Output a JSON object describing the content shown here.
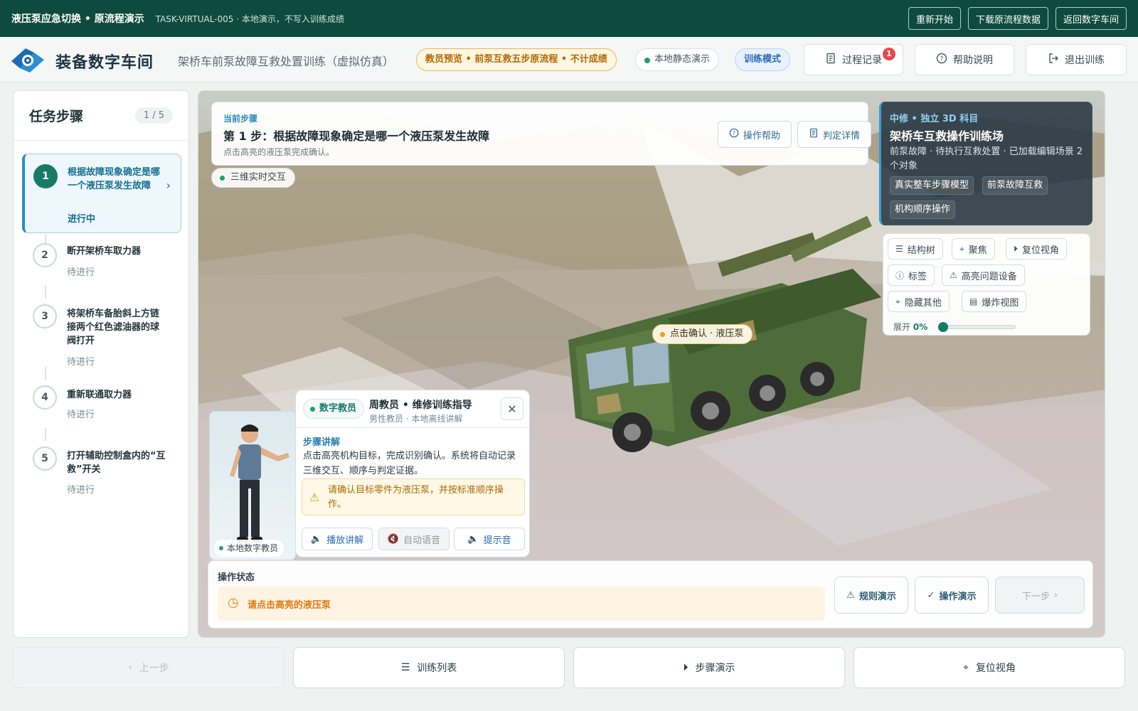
{
  "topbar": {
    "title": "液压泵应急切换 • 原流程演示",
    "task": "TASK-VIRTUAL-005 · 本地演示，不写入训练成绩",
    "buttons": [
      "重新开始",
      "下载原流程数据",
      "返回数字车间"
    ]
  },
  "header": {
    "brand": "装备数字车间",
    "subtitle": "架桥车前泵故障互救处置训练（虚拟仿真）",
    "preview_pill": "教员预览 • 前泵互救五步原流程 • 不计成绩",
    "demo_pill": "本地静态演示",
    "mode_pill": "训练模式",
    "record_button": "过程记录",
    "record_badge": "1",
    "help_button": "帮助说明",
    "exit_button": "退出训练"
  },
  "steps": {
    "title": "任务步骤",
    "count": "1 / 5",
    "items": [
      {
        "num": "1",
        "name": "根据故障现象确定是哪一个液压泵发生故障",
        "state": "进行中"
      },
      {
        "num": "2",
        "name": "断开架桥车取力器",
        "state": "待进行"
      },
      {
        "num": "3",
        "name": "将架桥车备胎斜上方链接两个红色滤油器的球阀打开",
        "state": "待进行"
      },
      {
        "num": "4",
        "name": "重新联通取力器",
        "state": "待进行"
      },
      {
        "num": "5",
        "name": "打开辅助控制盒内的“互救”开关",
        "state": "待进行"
      }
    ]
  },
  "stepcard": {
    "label": "当前步骤",
    "title": "第 1 步：根据故障现象确定是哪一个液压泵发生故障",
    "hint": "点击高亮的液压泵完成确认。",
    "help_button": "操作帮助",
    "detail_button": "判定详情"
  },
  "live_pill": "三维实时交互",
  "infocard": {
    "tag": "中修 • 独立 3D 科目",
    "title": "架桥车互救操作训练场",
    "desc": "前泵故障 · 待执行互救处置 · 已加载编辑场景 2 个对象",
    "chips": [
      "真实整车步骤模型",
      "前泵故障互救",
      "机构顺序操作"
    ]
  },
  "tools": {
    "buttons": [
      "结构树",
      "聚焦",
      "复位视角",
      "标签",
      "高亮问题设备",
      "隐藏其他",
      "爆炸视图"
    ],
    "expand_label": "展开",
    "expand_value": "0%",
    "expand_fraction": 0
  },
  "truck_label": "点击确认 · 液压泵",
  "avatar_caption": "本地数字教员",
  "tutor": {
    "role": "数字教员",
    "name": "周教员 • 维修训练指导",
    "sub": "男性教员 · 本地离线讲解",
    "section": "步骤讲解",
    "body": "点击高亮机构目标，完成识别确认。系统将自动记录三维交互、顺序与判定证据。",
    "warning": "请确认目标零件为液压泵，并按标准顺序操作。",
    "buttons": [
      "播放讲解",
      "自动语音",
      "提示音"
    ]
  },
  "opbar": {
    "label": "操作状态",
    "status": "请点击高亮的液压泵",
    "rule_button": "规则演示",
    "op_button": "操作演示",
    "next_button": "下一步"
  },
  "bottom": {
    "prev": "上一步",
    "list": "训练列表",
    "demo": "步骤演示",
    "reset": "复位视角"
  },
  "colors": {
    "topbar": "#0f4a40",
    "accent": "#167a66",
    "warn": "#e07a10",
    "info": "#2a8ab8"
  }
}
